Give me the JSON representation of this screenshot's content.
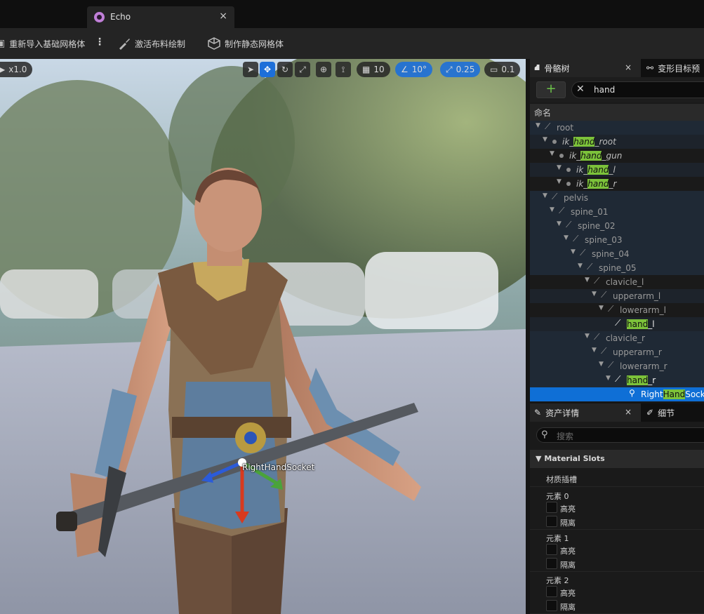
{
  "tab": {
    "title": "Echo",
    "close": "×"
  },
  "toolbar": {
    "reimport_label": "重新导入基础网格体",
    "more": "⋮",
    "cloth_paint_label": "激活布料绘制",
    "make_static_mesh_label": "制作静态网格体"
  },
  "viewport": {
    "speed": "x1.0",
    "grid_size": "10",
    "rotation_snap": "10°",
    "scale_snap": "0.25",
    "camera_speed": "0.1",
    "socket_label": "RightHandSocket"
  },
  "skeleton_panel": {
    "tab_label": "骨骼树",
    "tab_close": "×",
    "second_tab_label": "变形目标预",
    "add_label": "+",
    "search_value": "hand",
    "column_header": "命名",
    "highlight_color": "#7cc23a",
    "selection_color": "#0f6fd6",
    "rows": [
      {
        "pre": "root",
        "hl": "",
        "post": ""
      },
      {
        "pre": "ik_",
        "hl": "hand",
        "post": "_root"
      },
      {
        "pre": "ik_",
        "hl": "hand",
        "post": "_gun"
      },
      {
        "pre": "ik_",
        "hl": "hand",
        "post": "_l"
      },
      {
        "pre": "ik_",
        "hl": "hand",
        "post": "_r"
      },
      {
        "pre": "pelvis",
        "hl": "",
        "post": ""
      },
      {
        "pre": "spine_01",
        "hl": "",
        "post": ""
      },
      {
        "pre": "spine_02",
        "hl": "",
        "post": ""
      },
      {
        "pre": "spine_03",
        "hl": "",
        "post": ""
      },
      {
        "pre": "spine_04",
        "hl": "",
        "post": ""
      },
      {
        "pre": "spine_05",
        "hl": "",
        "post": ""
      },
      {
        "pre": "clavicle_l",
        "hl": "",
        "post": ""
      },
      {
        "pre": "upperarm_l",
        "hl": "",
        "post": ""
      },
      {
        "pre": "lowerarm_l",
        "hl": "",
        "post": ""
      },
      {
        "pre": "",
        "hl": "hand",
        "post": "_l"
      },
      {
        "pre": "clavicle_r",
        "hl": "",
        "post": ""
      },
      {
        "pre": "upperarm_r",
        "hl": "",
        "post": ""
      },
      {
        "pre": "lowerarm_r",
        "hl": "",
        "post": ""
      },
      {
        "pre": "",
        "hl": "hand",
        "post": "_r"
      },
      {
        "pre": "Right",
        "hl": "Hand",
        "post": "Socket"
      }
    ]
  },
  "details_panel": {
    "tab_label": "资产详情",
    "tab_close": "×",
    "second_tab_label": "细节",
    "search_placeholder": "搜索",
    "section_title": "Material Slots",
    "slots_label": "材质插槽",
    "elements": [
      {
        "label": "元素 0",
        "highlight": "高亮",
        "isolate": "隔离"
      },
      {
        "label": "元素 1",
        "highlight": "高亮",
        "isolate": "隔离"
      },
      {
        "label": "元素 2",
        "highlight": "高亮",
        "isolate": "隔离"
      }
    ]
  }
}
